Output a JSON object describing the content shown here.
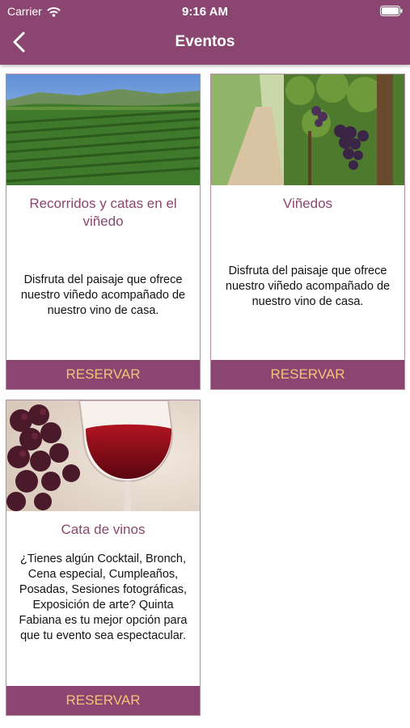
{
  "status_bar": {
    "carrier": "Carrier",
    "time": "9:16 AM"
  },
  "header": {
    "title": "Eventos"
  },
  "events": [
    {
      "title": "Recorridos y catas en el viñedo",
      "description": "Disfruta del paisaje que ofrece nuestro viñedo acompañado de nuestro vino de casa.",
      "button_label": "RESERVAR"
    },
    {
      "title": "Viñedos",
      "description": "Disfruta del paisaje que ofrece nuestro viñedo acompañado de nuestro vino de casa.",
      "button_label": "RESERVAR"
    },
    {
      "title": "Cata de vinos",
      "description": "¿Tienes algún Cocktail, Bronch, Cena especial, Cumpleaños, Posadas, Sesiones fotográficas, Exposición de arte? Quinta Fabiana es tu mejor opción para que tu evento sea espectacular.",
      "button_label": "RESERVAR"
    }
  ],
  "colors": {
    "brand": "#8a4670",
    "button_text": "#f3c37a"
  }
}
